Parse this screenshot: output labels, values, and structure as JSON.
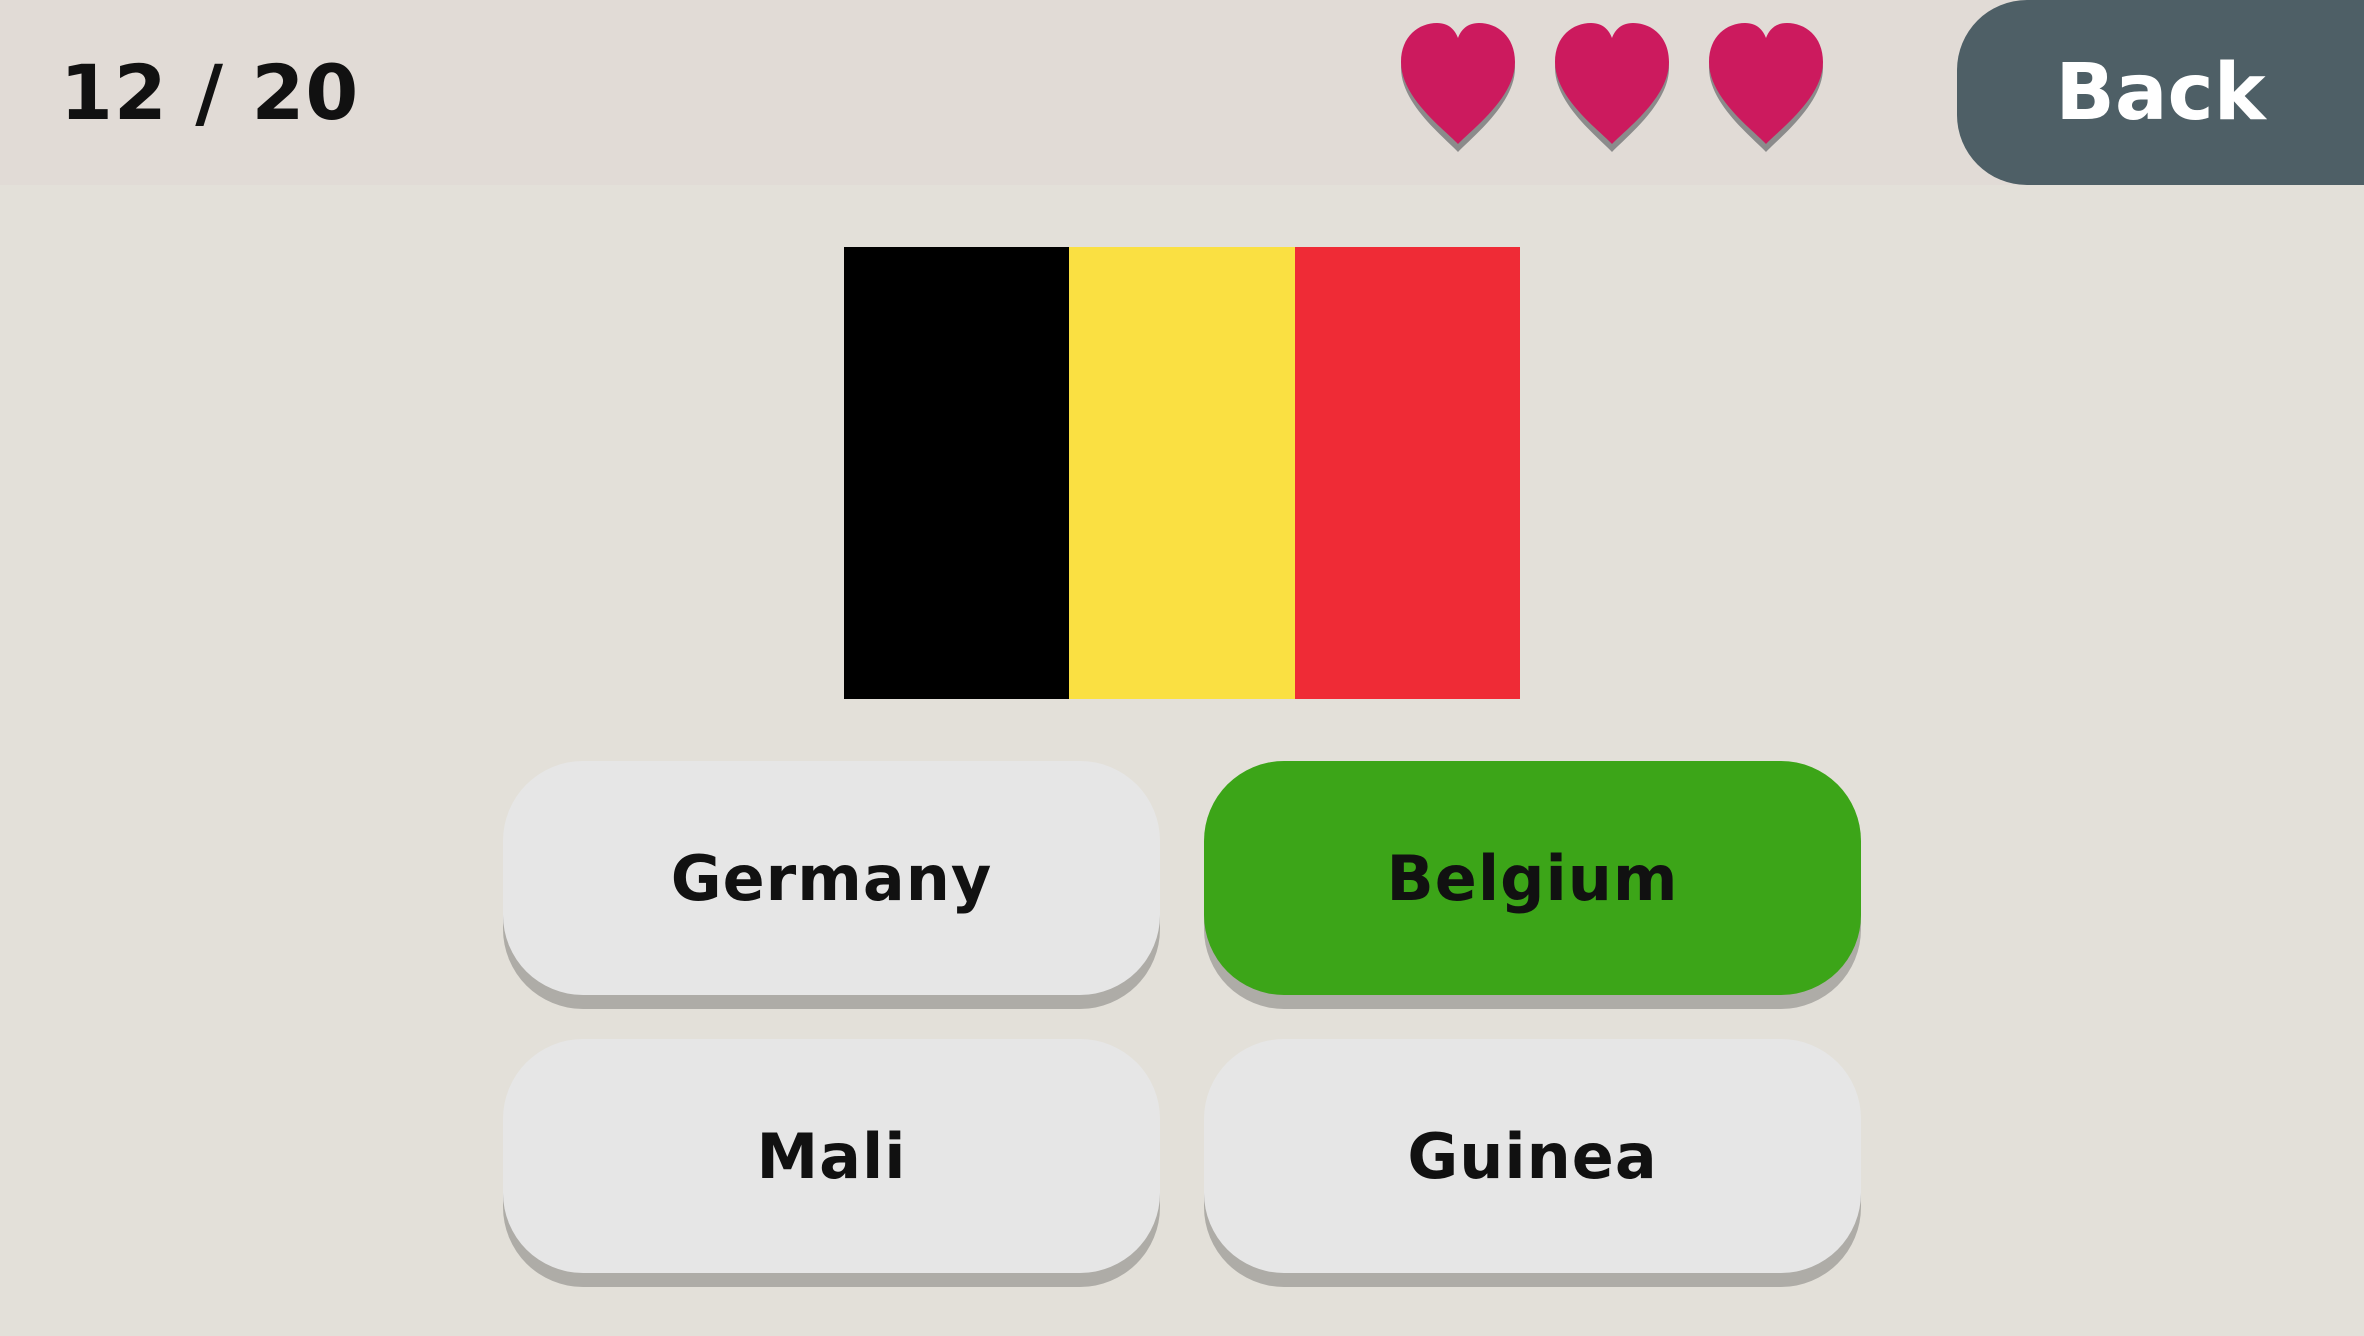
{
  "header": {
    "progress": "12 / 20",
    "lives": 3,
    "heart_color": "#cc1a5e",
    "back_label": "Back"
  },
  "flag": {
    "country": "Belgium",
    "stripes": [
      "#000000",
      "#fae042",
      "#ef2b36"
    ]
  },
  "answers": [
    {
      "label": "Germany",
      "state": "normal"
    },
    {
      "label": "Belgium",
      "state": "correct"
    },
    {
      "label": "Mali",
      "state": "normal"
    },
    {
      "label": "Guinea",
      "state": "normal"
    }
  ],
  "colors": {
    "background": "#e3e0d9",
    "topbar": "#e1dbd6",
    "back_button": "#4e5f66",
    "answer_default": "#e6e6e6",
    "answer_correct": "#3ca518"
  }
}
